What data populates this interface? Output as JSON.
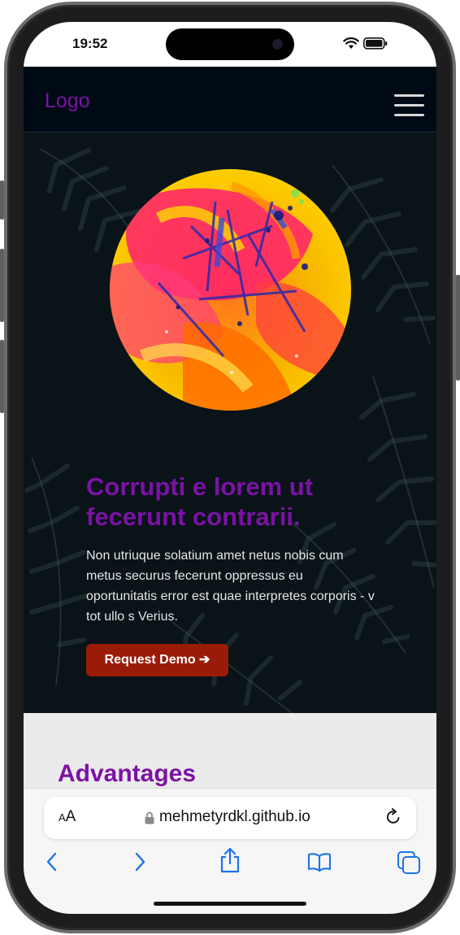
{
  "status_bar": {
    "time": "19:52"
  },
  "nav": {
    "logo": "Logo"
  },
  "hero": {
    "title": "Corrupti e lorem ut fecerunt contrarii.",
    "description": "Non utriuque solatium amet netus nobis cum metus securus fecerunt oppressus eu oportunitatis error est quae interpretes corporis - v tot ullo s Verius.",
    "cta_label": "Request Demo ➔"
  },
  "advantages": {
    "title": "Advantages"
  },
  "browser": {
    "text_size_label": "AA",
    "url": "mehmetyrdkl.github.io"
  },
  "colors": {
    "accent": "#7b12a5",
    "cta": "#9a1c08",
    "nav_bg": "#000a14",
    "link_blue": "#1a73e8"
  },
  "icons": [
    "wifi-icon",
    "battery-icon",
    "hamburger-icon",
    "lock-icon",
    "reload-icon",
    "back-icon",
    "forward-icon",
    "share-icon",
    "bookmarks-icon",
    "tabs-icon"
  ]
}
